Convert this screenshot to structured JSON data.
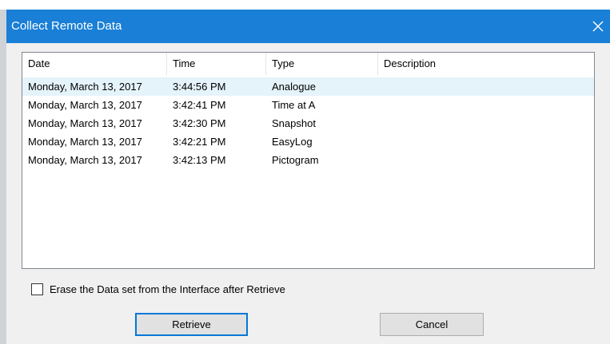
{
  "window": {
    "title": "Collect Remote Data",
    "close_icon": "close-icon"
  },
  "colors": {
    "titlebar": "#1a7fd6",
    "row_hover": "#e5f3fb",
    "default_button_border": "#0078d7"
  },
  "list": {
    "columns": [
      "Date",
      "Time",
      "Type",
      "Description"
    ],
    "rows": [
      {
        "date": "Monday, March 13, 2017",
        "time": "3:44:56 PM",
        "type": "Analogue",
        "description": ""
      },
      {
        "date": "Monday, March 13, 2017",
        "time": "3:42:41 PM",
        "type": "Time at A",
        "description": ""
      },
      {
        "date": "Monday, March 13, 2017",
        "time": "3:42:30 PM",
        "type": "Snapshot",
        "description": ""
      },
      {
        "date": "Monday, March 13, 2017",
        "time": "3:42:21 PM",
        "type": "EasyLog",
        "description": ""
      },
      {
        "date": "Monday, March 13, 2017",
        "time": "3:42:13 PM",
        "type": "Pictogram",
        "description": ""
      }
    ]
  },
  "options": {
    "erase_label": "Erase the Data set from the Interface after Retrieve",
    "erase_checked": false
  },
  "buttons": {
    "retrieve": "Retrieve",
    "cancel": "Cancel"
  }
}
